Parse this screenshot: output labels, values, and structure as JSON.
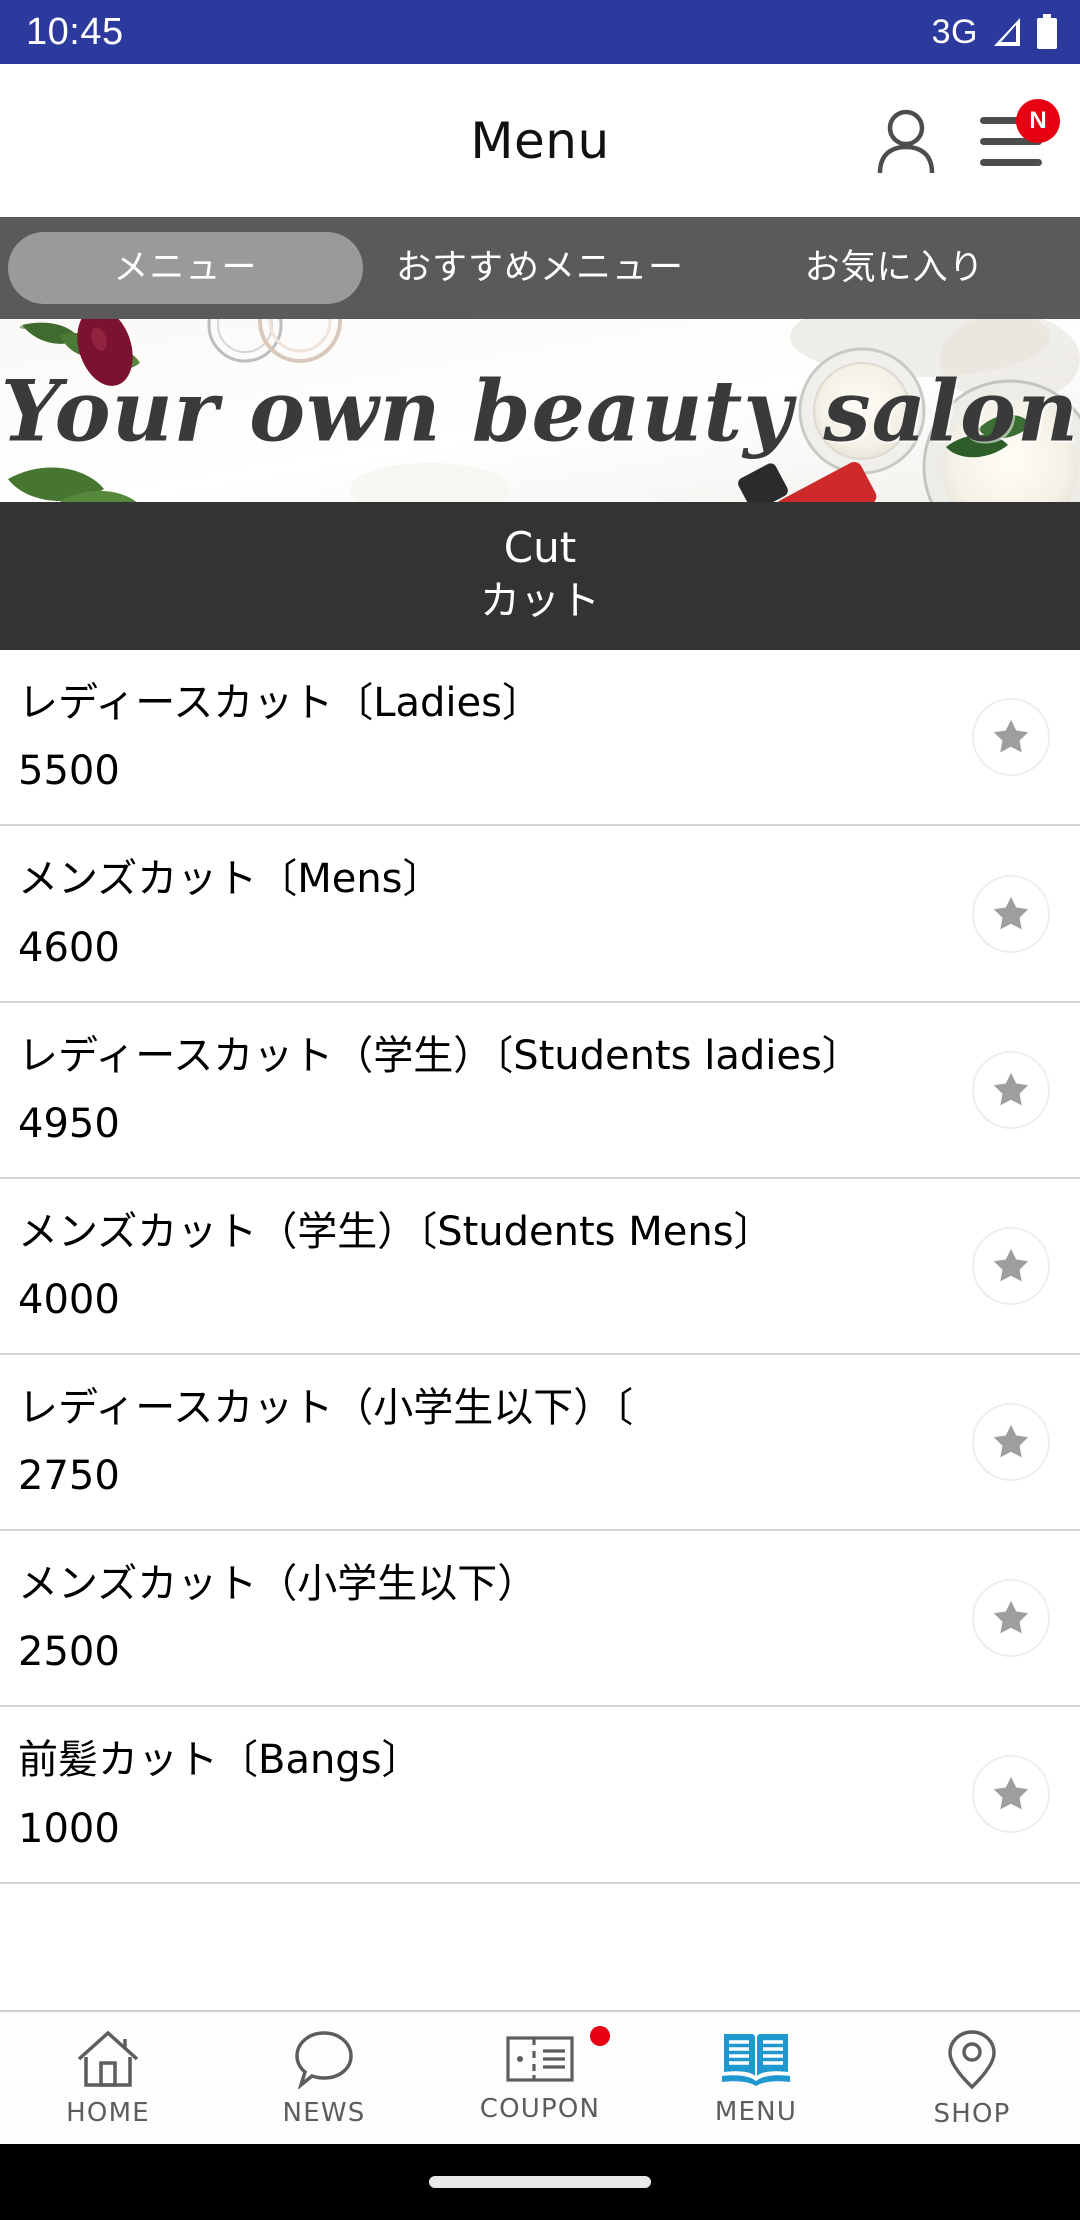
{
  "status_bar": {
    "time": "10:45",
    "network": "3G",
    "signal_icon": "signal-bars-icon",
    "battery_icon": "battery-full-icon",
    "background_color": "#2c3a9e"
  },
  "app_bar": {
    "title": "Menu",
    "account_icon": "person-icon",
    "menu_icon": "hamburger-menu-icon",
    "badge_label": "N",
    "badge_color": "#e60012"
  },
  "tabs": {
    "items": [
      {
        "label": "メニュー",
        "active": true
      },
      {
        "label": "おすすめメニュー",
        "active": false
      },
      {
        "label": "お気に入り",
        "active": false
      }
    ],
    "bar_color": "#5a5a5a",
    "active_pill_color": "#9a9a9a"
  },
  "hero": {
    "script_text": "Your own beauty salon",
    "alt": "beauty salon banner with olive branches and cream jars"
  },
  "category": {
    "title_en": "Cut",
    "title_jp": "カット",
    "background_color": "#333333"
  },
  "menu_items": [
    {
      "name": "レディースカット〔Ladies〕",
      "price": "5500",
      "favorite_icon": "star-icon"
    },
    {
      "name": "メンズカット〔Mens〕",
      "price": "4600",
      "favorite_icon": "star-icon"
    },
    {
      "name": "レディースカット（学生）〔Students ladies〕",
      "price": "4950",
      "favorite_icon": "star-icon"
    },
    {
      "name": "メンズカット（学生）〔Students Mens〕",
      "price": "4000",
      "favorite_icon": "star-icon"
    },
    {
      "name": "レディースカット（小学生以下）〔",
      "price": "2750",
      "favorite_icon": "star-icon"
    },
    {
      "name": "メンズカット（小学生以下）",
      "price": "2500",
      "favorite_icon": "star-icon"
    },
    {
      "name": "前髪カット〔Bangs〕",
      "price": "1000",
      "favorite_icon": "star-icon"
    }
  ],
  "bottom_nav": {
    "items": [
      {
        "label": "HOME",
        "icon": "home-icon",
        "active": false,
        "has_dot": false
      },
      {
        "label": "NEWS",
        "icon": "speech-bubble-icon",
        "active": false,
        "has_dot": false
      },
      {
        "label": "COUPON",
        "icon": "ticket-icon",
        "active": false,
        "has_dot": true
      },
      {
        "label": "MENU",
        "icon": "open-book-icon",
        "active": true,
        "has_dot": false
      },
      {
        "label": "SHOP",
        "icon": "map-pin-icon",
        "active": false,
        "has_dot": false
      }
    ],
    "active_color": "#1f97cf",
    "inactive_color": "#5d5d5d",
    "dot_color": "#e60012"
  }
}
